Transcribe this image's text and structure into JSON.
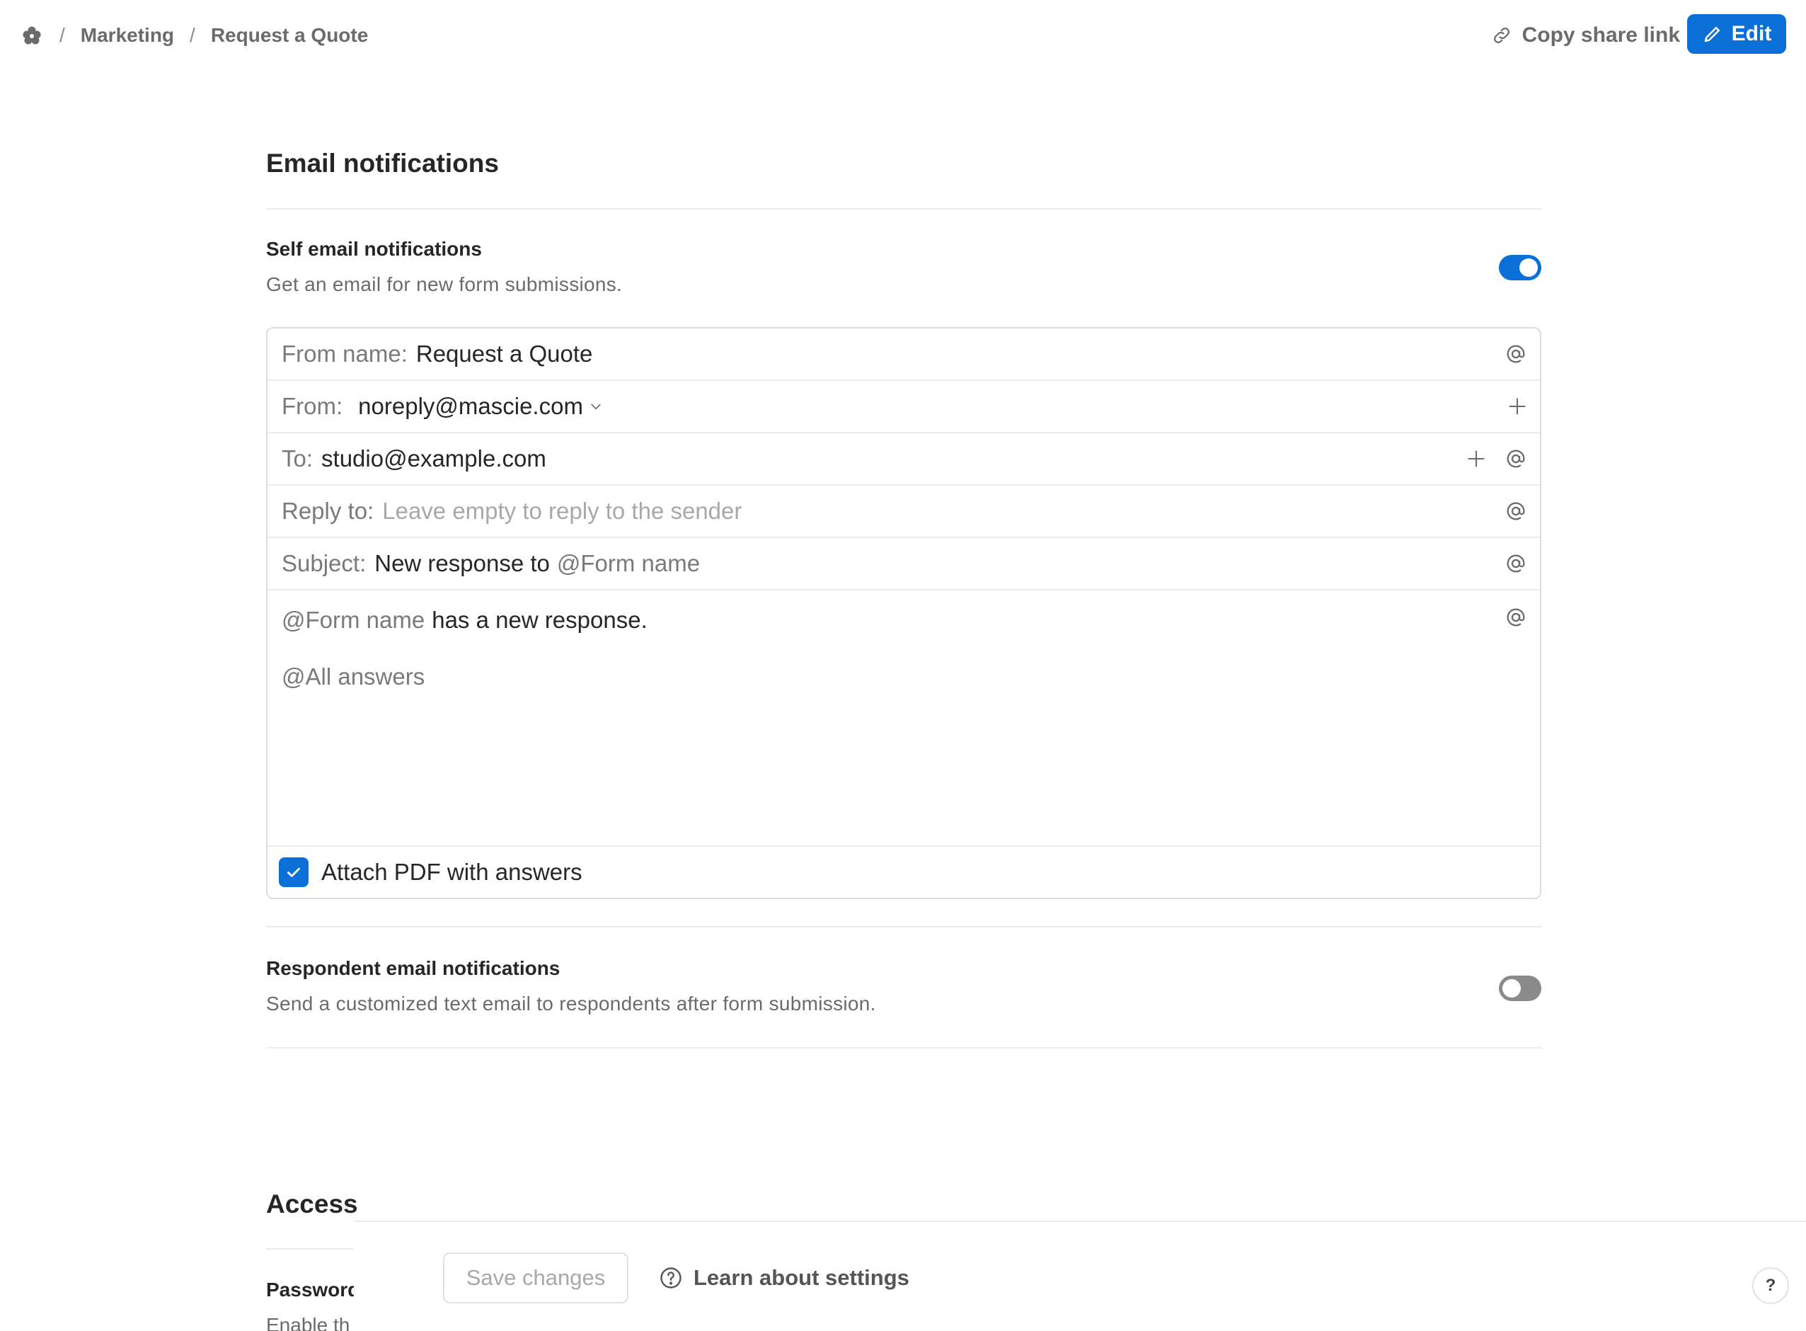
{
  "breadcrumb": {
    "separator": "/",
    "items": [
      "Marketing",
      "Request a Quote"
    ]
  },
  "header": {
    "copy_share_link": "Copy share link",
    "edit": "Edit"
  },
  "email_notifications": {
    "title": "Email notifications",
    "self": {
      "label": "Self email notifications",
      "description": "Get an email for new form submissions.",
      "enabled": true
    },
    "fields": {
      "from_name": {
        "label": "From name:",
        "value": "Request a Quote"
      },
      "from": {
        "label": "From:",
        "value": "noreply@mascie.com"
      },
      "to": {
        "label": "To:",
        "value": "studio@example.com"
      },
      "reply_to": {
        "label": "Reply to:",
        "placeholder": "Leave empty to reply to the sender"
      },
      "subject": {
        "label": "Subject:",
        "text": "New response to",
        "token": "@Form name"
      }
    },
    "body": {
      "token1": "@Form name",
      "text1": "has a new response.",
      "token2": "@All answers"
    },
    "attach_pdf": {
      "label": "Attach PDF with answers",
      "checked": true
    },
    "respondent": {
      "label": "Respondent email notifications",
      "description": "Send a customized text email to respondents after form submission.",
      "enabled": false
    }
  },
  "access": {
    "title": "Access",
    "password_label": "Password",
    "password_desc": "Enable th"
  },
  "footer": {
    "save_changes": "Save changes",
    "learn": "Learn about settings",
    "help": "?"
  },
  "colors": {
    "accent": "#0b6fd8",
    "toggle_off": "#8a8a8a",
    "muted_text": "#6b6b6b"
  }
}
